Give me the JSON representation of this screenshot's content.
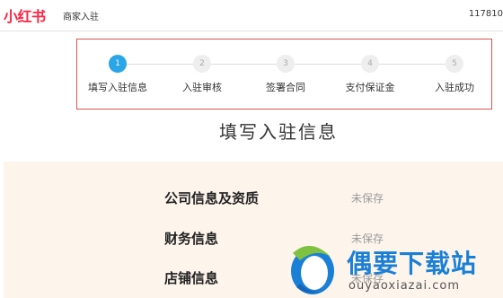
{
  "header": {
    "logo_text": "小红书",
    "merchant_label": "商家入驻",
    "account_id": "117810"
  },
  "steps": [
    {
      "number": "1",
      "label": "填写入驻信息",
      "active": true
    },
    {
      "number": "2",
      "label": "入驻审核",
      "active": false
    },
    {
      "number": "3",
      "label": "签署合同",
      "active": false
    },
    {
      "number": "4",
      "label": "支付保证金",
      "active": false
    },
    {
      "number": "5",
      "label": "入驻成功",
      "active": false
    }
  ],
  "main": {
    "title": "填写入驻信息",
    "sections": [
      {
        "name": "公司信息及资质",
        "status": "未保存"
      },
      {
        "name": "财务信息",
        "status": "未保存"
      },
      {
        "name": "店铺信息",
        "status": "未保存"
      }
    ]
  },
  "watermark": {
    "title": "偶要下载站",
    "url": "ouyaoxiazai.com"
  },
  "colors": {
    "brand": "#ff2442",
    "active_step": "#29a5e8",
    "panel_bg": "#fdf5ec",
    "highlight_border": "#d9534f"
  }
}
